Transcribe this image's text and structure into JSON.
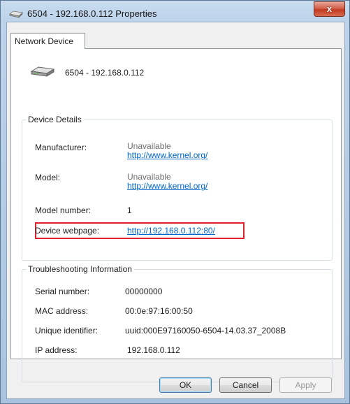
{
  "window": {
    "title": "6504 - 192.168.0.112 Properties",
    "close_glyph": "x",
    "title_icon": "network-device-icon"
  },
  "tabs": [
    {
      "label": "Network Device",
      "selected": true
    }
  ],
  "device": {
    "name": "6504 - 192.168.0.112",
    "icon": "network-device-icon"
  },
  "device_details": {
    "legend": "Device Details",
    "manufacturer": {
      "label": "Manufacturer:",
      "value": "Unavailable",
      "link": "http://www.kernel.org/"
    },
    "model": {
      "label": "Model:",
      "value": "Unavailable",
      "link": "http://www.kernel.org/"
    },
    "model_number": {
      "label": "Model number:",
      "value": "1"
    },
    "device_webpage": {
      "label": "Device webpage:",
      "link": "http://192.168.0.112:80/"
    }
  },
  "troubleshooting": {
    "legend": "Troubleshooting Information",
    "serial_number": {
      "label": "Serial number:",
      "value": "00000000"
    },
    "mac_address": {
      "label": "MAC address:",
      "value": "00:0e:97:16:00:50"
    },
    "unique_identifier": {
      "label": "Unique identifier:",
      "value": "uuid:000E97160050-6504-14.03.37_2008B"
    },
    "ip_address": {
      "label": "IP address:",
      "value": "192.168.0.112"
    }
  },
  "buttons": {
    "ok": "OK",
    "cancel": "Cancel",
    "apply": "Apply"
  },
  "colors": {
    "link": "#0066cc",
    "highlight_box": "#e0212e",
    "close_button": "#c23b22"
  }
}
